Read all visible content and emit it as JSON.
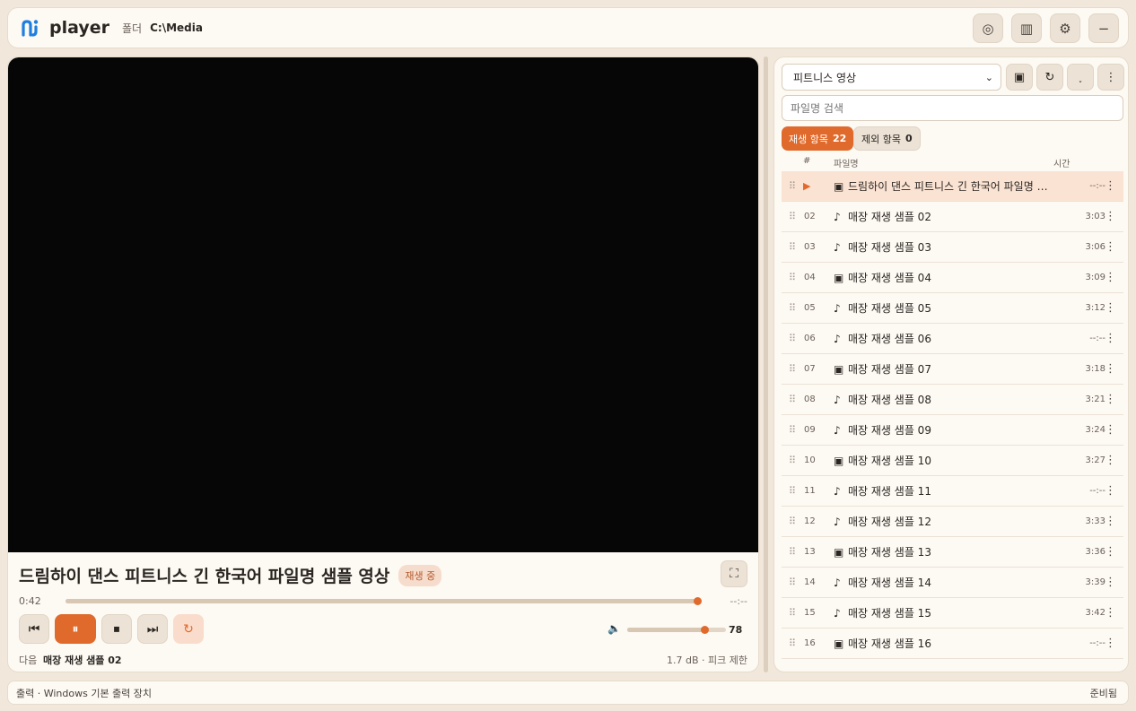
{
  "header": {
    "app_name": "player",
    "folder_label": "폴더",
    "folder_path": "C:\\Media",
    "buttons": [
      {
        "name": "disc-icon",
        "glyph": "◎"
      },
      {
        "name": "columns-icon",
        "glyph": "▥"
      },
      {
        "name": "gear-icon",
        "glyph": "⚙"
      },
      {
        "name": "minimize-icon",
        "glyph": "−"
      }
    ]
  },
  "player": {
    "title": "드림하이 댄스 피트니스 긴 한국어 파일명 샘플 영상",
    "status": "재생 중",
    "time_current": "0:42",
    "time_total": "--:--",
    "seek_fraction": 0.997,
    "volume_value": "78",
    "volume_fraction": 0.78,
    "next_label": "다음",
    "next_title": "매장 재생 샘플 02",
    "gain_text": "1.7 dB · 피크 제한",
    "controls": {
      "prev": "⏮",
      "pause": "⏸",
      "stop": "⏹",
      "next": "⏭",
      "repeat": "↻",
      "fullscreen": "⛶",
      "volume": "🔈"
    }
  },
  "playlist": {
    "selected": "피트니스 영상",
    "search_placeholder": "파일명 검색",
    "tab_active_label": "재생 항목",
    "tab_active_count": "22",
    "tab_inactive_label": "제외 항목",
    "tab_inactive_count": "0",
    "col_num": "#",
    "col_name": "파일명",
    "col_time": "시간",
    "rows": [
      {
        "num": "",
        "type": "video",
        "name": "드림하이 댄스 피트니스 긴 한국어 파일명 샘플 영상",
        "dur": "--:--",
        "current": true
      },
      {
        "num": "02",
        "type": "audio",
        "name": "매장 재생 샘플 02",
        "dur": "3:03"
      },
      {
        "num": "03",
        "type": "audio",
        "name": "매장 재생 샘플 03",
        "dur": "3:06"
      },
      {
        "num": "04",
        "type": "video",
        "name": "매장 재생 샘플 04",
        "dur": "3:09"
      },
      {
        "num": "05",
        "type": "audio",
        "name": "매장 재생 샘플 05",
        "dur": "3:12"
      },
      {
        "num": "06",
        "type": "audio",
        "name": "매장 재생 샘플 06",
        "dur": "--:--"
      },
      {
        "num": "07",
        "type": "video",
        "name": "매장 재생 샘플 07",
        "dur": "3:18"
      },
      {
        "num": "08",
        "type": "audio",
        "name": "매장 재생 샘플 08",
        "dur": "3:21"
      },
      {
        "num": "09",
        "type": "audio",
        "name": "매장 재생 샘플 09",
        "dur": "3:24"
      },
      {
        "num": "10",
        "type": "video",
        "name": "매장 재생 샘플 10",
        "dur": "3:27"
      },
      {
        "num": "11",
        "type": "audio",
        "name": "매장 재생 샘플 11",
        "dur": "--:--"
      },
      {
        "num": "12",
        "type": "audio",
        "name": "매장 재생 샘플 12",
        "dur": "3:33"
      },
      {
        "num": "13",
        "type": "video",
        "name": "매장 재생 샘플 13",
        "dur": "3:36"
      },
      {
        "num": "14",
        "type": "audio",
        "name": "매장 재생 샘플 14",
        "dur": "3:39"
      },
      {
        "num": "15",
        "type": "audio",
        "name": "매장 재생 샘플 15",
        "dur": "3:42"
      },
      {
        "num": "16",
        "type": "video",
        "name": "매장 재생 샘플 16",
        "dur": "--:--"
      }
    ]
  },
  "statusbar": {
    "left": "출력 · Windows 기본 출력 장치",
    "right": "준비됨"
  },
  "colors": {
    "accent": "#e06a2c",
    "accent_soft": "#fbe3d3",
    "background": "#f1e8db",
    "card": "#fdf9f3",
    "video": "#060606",
    "logo": "#1d7fe0"
  }
}
